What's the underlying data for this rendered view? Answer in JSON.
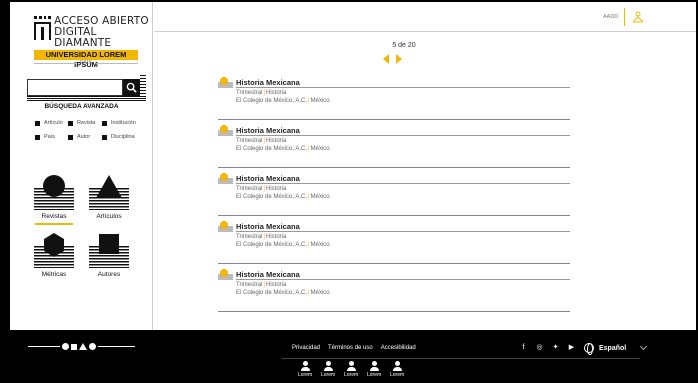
{
  "brand": {
    "line1": "ACCESO ABIERTO",
    "line2": "DIGITAL DIAMANTE",
    "university": "UNIVERSIDAD LOREM IPSUM",
    "country": "PAÍS",
    "accent_color": "#f2b705"
  },
  "search": {
    "placeholder": "",
    "advanced_label": "BÚSQUEDA AVANZADA",
    "filters": [
      {
        "label": "Artículo"
      },
      {
        "label": "Revista"
      },
      {
        "label": "Institución"
      },
      {
        "label": "País"
      },
      {
        "label": "Autor"
      },
      {
        "label": "Disciplina"
      }
    ]
  },
  "categories": [
    {
      "label": "Revistas",
      "icon": "circle-icon",
      "active": true
    },
    {
      "label": "Artículos",
      "icon": "triangle-icon",
      "active": false
    },
    {
      "label": "Métricas",
      "icon": "hexagon-icon",
      "active": false
    },
    {
      "label": "Autores",
      "icon": "square-icon",
      "active": false
    }
  ],
  "topbar": {
    "user_label": "AADD",
    "icon": "reader-icon"
  },
  "pager": {
    "text": "5 de 20"
  },
  "results": [
    {
      "title": "Historia Mexicana",
      "frequency": "Trimestral",
      "discipline": "Historia",
      "publisher": "El Colegio de México, A.C.",
      "country": "México"
    },
    {
      "title": "Historia Mexicana",
      "frequency": "Trimestral",
      "discipline": "Historia",
      "publisher": "El Colegio de México, A.C.",
      "country": "México"
    },
    {
      "title": "Historia Mexicana",
      "frequency": "Trimestral",
      "discipline": "Historia",
      "publisher": "El Colegio de México, A.C.",
      "country": "México"
    },
    {
      "title": "Historia Mexicana",
      "frequency": "Trimestral",
      "discipline": "Historia",
      "publisher": "El Colegio de México, A.C.",
      "country": "México"
    },
    {
      "title": "Historia Mexicana",
      "frequency": "Trimestral",
      "discipline": "Historia",
      "publisher": "El Colegio de México, A.C.",
      "country": "México"
    }
  ],
  "footer": {
    "links": [
      "Privacidad",
      "Términos de uso",
      "Accesibilidad"
    ],
    "social": [
      "facebook-icon",
      "instagram-icon",
      "twitter-icon",
      "youtube-icon"
    ],
    "language": "Español",
    "people": [
      "Lorem",
      "Lorem",
      "Lorem",
      "Lorem",
      "Lorem"
    ]
  }
}
